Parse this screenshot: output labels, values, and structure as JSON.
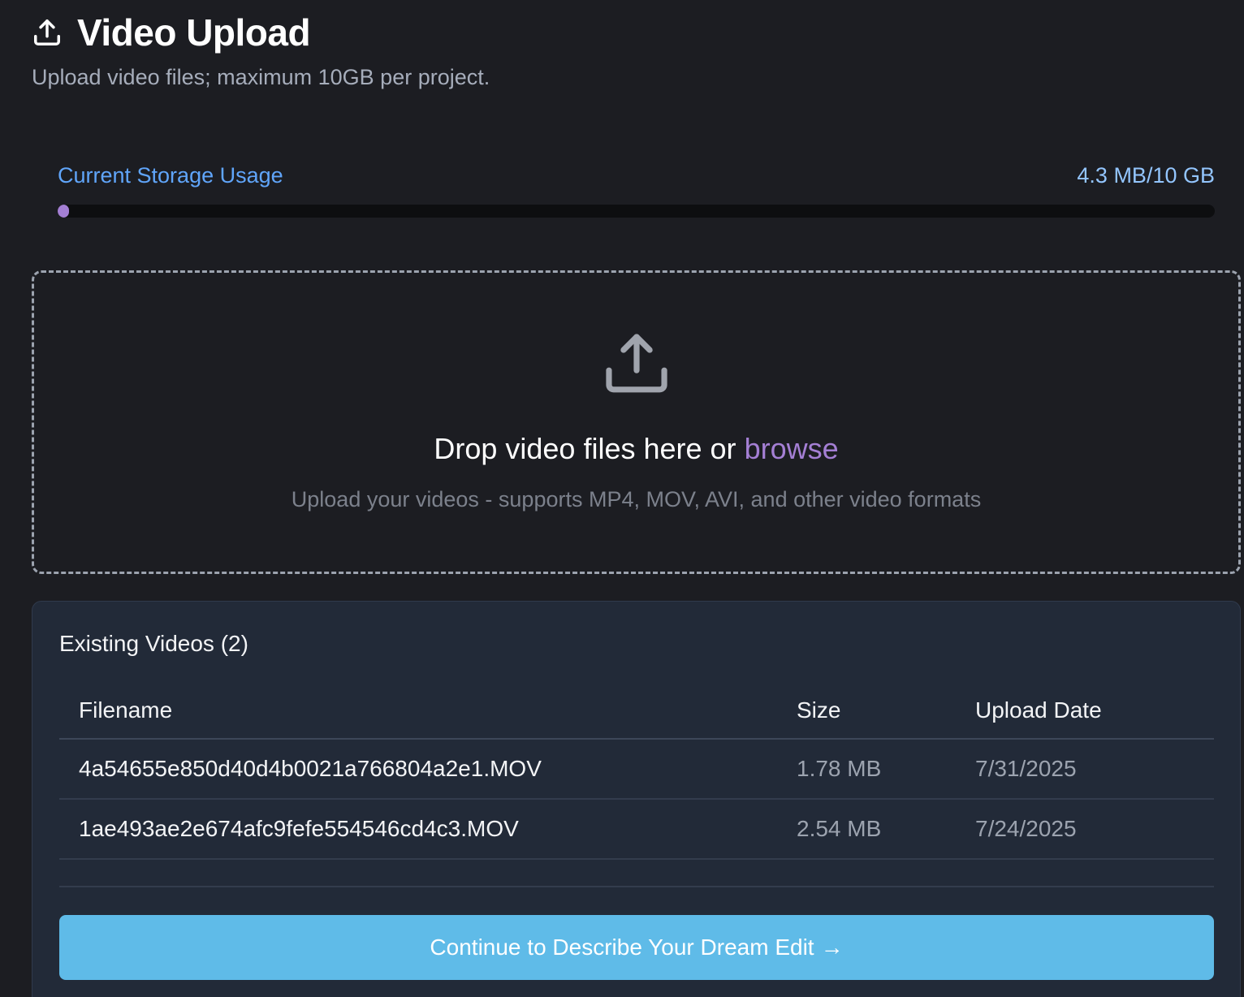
{
  "header": {
    "title": "Video Upload",
    "subtitle": "Upload video files; maximum 10GB per project.",
    "icon": "upload-icon"
  },
  "storage": {
    "label": "Current Storage Usage",
    "value_text": "4.3 MB/10 GB",
    "used_fraction": 0.00042,
    "fill_color": "#a47fd4"
  },
  "dropzone": {
    "icon": "upload-icon",
    "title_prefix": "Drop video files here or",
    "browse_label": "browse",
    "subtitle": "Upload your videos - supports MP4, MOV, AVI, and other video formats"
  },
  "videos": {
    "title": "Existing Videos (2)",
    "columns": [
      "Filename",
      "Size",
      "Upload Date"
    ],
    "rows": [
      {
        "filename": "4a54655e850d40d4b0021a766804a2e1.MOV",
        "size": "1.78 MB",
        "date": "7/31/2025"
      },
      {
        "filename": "1ae493ae2e674afc9fefe554546cd4c3.MOV",
        "size": "2.54 MB",
        "date": "7/24/2025"
      }
    ]
  },
  "continue_button": {
    "label": "Continue to Describe Your Dream Edit",
    "arrow": "→",
    "color": "#5fbbe8"
  }
}
